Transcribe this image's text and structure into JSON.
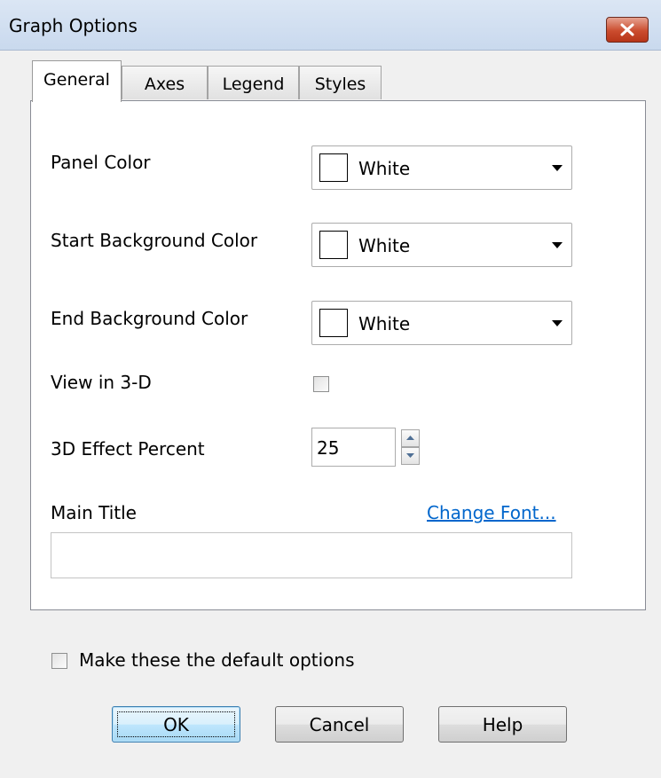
{
  "window": {
    "title": "Graph Options"
  },
  "tabs": [
    {
      "label": "General",
      "active": true
    },
    {
      "label": "Axes",
      "active": false
    },
    {
      "label": "Legend",
      "active": false
    },
    {
      "label": "Styles",
      "active": false
    }
  ],
  "general": {
    "panel_color": {
      "label": "Panel Color",
      "value": "White",
      "swatch": "#ffffff"
    },
    "start_background_color": {
      "label": "Start Background Color",
      "value": "White",
      "swatch": "#ffffff"
    },
    "end_background_color": {
      "label": "End Background Color",
      "value": "White",
      "swatch": "#ffffff"
    },
    "view_3d": {
      "label": "View in 3-D",
      "checked": false
    },
    "effect_percent": {
      "label": "3D Effect Percent",
      "value": "25"
    },
    "main_title": {
      "label": "Main Title",
      "value": "",
      "change_font_link": "Change Font..."
    }
  },
  "default_options": {
    "label": "Make these the default options",
    "checked": false
  },
  "buttons": {
    "ok": "OK",
    "cancel": "Cancel",
    "help": "Help"
  },
  "colors": {
    "link": "#0066cc",
    "close_button": "#c7472b",
    "title_bar": "#d4e1f2"
  },
  "icons": {
    "close": "close-icon",
    "dropdown": "chevron-down-icon",
    "spin_up": "spin-up-icon",
    "spin_down": "spin-down-icon"
  }
}
